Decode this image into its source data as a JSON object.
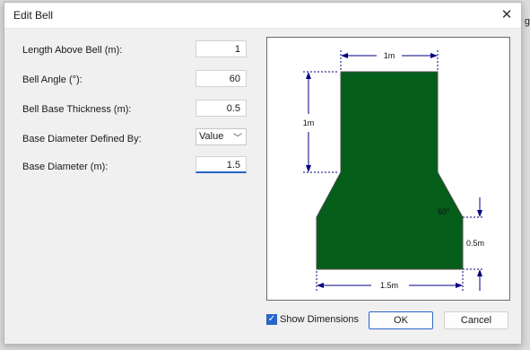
{
  "background": {
    "right_edge_text": "g"
  },
  "dialog": {
    "title": "Edit Bell",
    "close_icon": "close-icon"
  },
  "fields": {
    "length_above_bell": {
      "label": "Length Above Bell (m):",
      "value": "1"
    },
    "bell_angle": {
      "label": "Bell Angle (°):",
      "value": "60"
    },
    "bell_base_thickness": {
      "label": "Bell Base Thickness (m):",
      "value": "0.5"
    },
    "base_diameter_defined_by": {
      "label": "Base Diameter Defined By:",
      "value": "Value"
    },
    "base_diameter": {
      "label": "Base Diameter (m):",
      "value": "1.5"
    }
  },
  "diagram": {
    "shape_color": "#045e1a",
    "dimension_color": "#000080",
    "top_width_label": "1m",
    "shaft_height_label": "1m",
    "angle_label": "60°",
    "base_thickness_label": "0.5m",
    "base_width_label": "1.5m"
  },
  "footer": {
    "show_dimensions_label": "Show Dimensions",
    "show_dimensions_checked": true,
    "ok_label": "OK",
    "cancel_label": "Cancel"
  }
}
